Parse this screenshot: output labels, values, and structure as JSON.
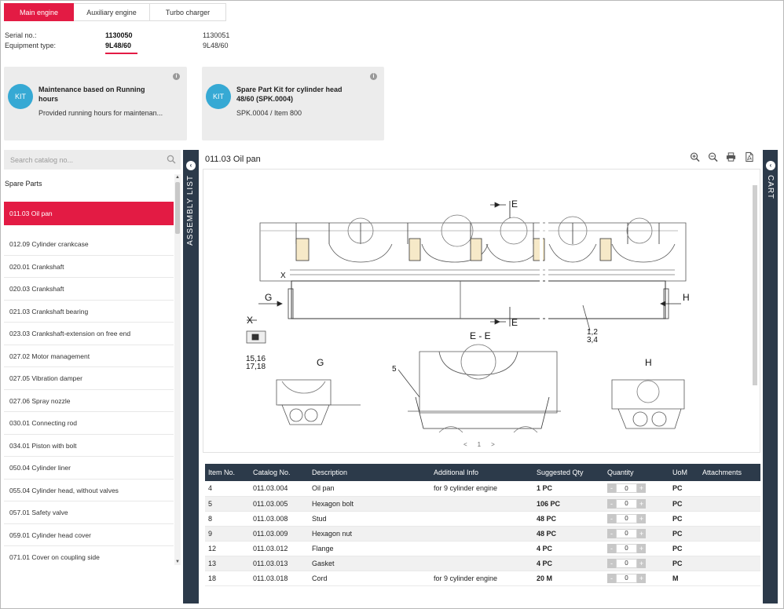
{
  "tabs": [
    {
      "label": "Main engine"
    },
    {
      "label": "Auxiliary engine"
    },
    {
      "label": "Turbo charger"
    }
  ],
  "equipment": {
    "serial_label": "Serial no.:",
    "type_label": "Equipment type:",
    "col1_serial": "1130050",
    "col1_type": "9L48/60",
    "col2_serial": "1130051",
    "col2_type": "9L48/60"
  },
  "kits": [
    {
      "badge": "KIT",
      "title": "Maintenance based on Running hours",
      "desc": "Provided running hours for maintenan..."
    },
    {
      "badge": "KIT",
      "title": "Spare Part Kit for cylinder head 48/60 (SPK.0004)",
      "desc": "SPK.0004 / Item 800"
    }
  ],
  "search": {
    "placeholder": "Search catalog no..."
  },
  "spare_parts_title": "Spare Parts",
  "assembly_items": [
    "011.03 Oil pan",
    "012.09 Cylinder crankcase",
    "020.01 Crankshaft",
    "020.03 Crankshaft",
    "021.03 Crankshaft bearing",
    "023.03 Crankshaft-extension on free end",
    "027.02 Motor management",
    "027.05 Vibration damper",
    "027.06 Spray nozzle",
    "030.01 Connecting rod",
    "034.01 Piston with bolt",
    "050.04 Cylinder liner",
    "055.04 Cylinder head, without valves",
    "057.01 Safety valve",
    "059.01 Cylinder head cover",
    "071.01 Cover on coupling side"
  ],
  "side_labels": {
    "left": "ASSEMBLY LIST",
    "right": "CART"
  },
  "main_title": "011.03 Oil pan",
  "drawing": {
    "labels": [
      "E",
      "E",
      "G",
      "H",
      "X",
      "X",
      "1,2",
      "3,4",
      "15,16",
      "17,18",
      "E - E",
      "G",
      "H",
      "5"
    ],
    "pager": {
      "prev": "<",
      "page": "1",
      "next": ">"
    }
  },
  "table": {
    "headers": [
      "Item No.",
      "Catalog No.",
      "Description",
      "Additional Info",
      "Suggested Qty",
      "Quantity",
      "UoM",
      "Attachments"
    ],
    "rows": [
      {
        "item": "4",
        "catalog": "011.03.004",
        "desc": "Oil pan",
        "info": "for 9 cylinder engine",
        "qty": "1 PC",
        "quantity": "0",
        "uom": "PC"
      },
      {
        "item": "5",
        "catalog": "011.03.005",
        "desc": "Hexagon bolt",
        "info": "",
        "qty": "106 PC",
        "quantity": "0",
        "uom": "PC"
      },
      {
        "item": "8",
        "catalog": "011.03.008",
        "desc": "Stud",
        "info": "",
        "qty": "48 PC",
        "quantity": "0",
        "uom": "PC"
      },
      {
        "item": "9",
        "catalog": "011.03.009",
        "desc": "Hexagon nut",
        "info": "",
        "qty": "48 PC",
        "quantity": "0",
        "uom": "PC"
      },
      {
        "item": "12",
        "catalog": "011.03.012",
        "desc": "Flange",
        "info": "",
        "qty": "4 PC",
        "quantity": "0",
        "uom": "PC"
      },
      {
        "item": "13",
        "catalog": "011.03.013",
        "desc": "Gasket",
        "info": "",
        "qty": "4 PC",
        "quantity": "0",
        "uom": "PC"
      },
      {
        "item": "18",
        "catalog": "011.03.018",
        "desc": "Cord",
        "info": "for 9 cylinder engine",
        "qty": "20 M",
        "quantity": "0",
        "uom": "M"
      }
    ],
    "minus": "-",
    "plus": "+"
  },
  "colors": {
    "accent": "#e31b44",
    "navy": "#2c3a4a",
    "kit_badge": "#36a9d4"
  }
}
